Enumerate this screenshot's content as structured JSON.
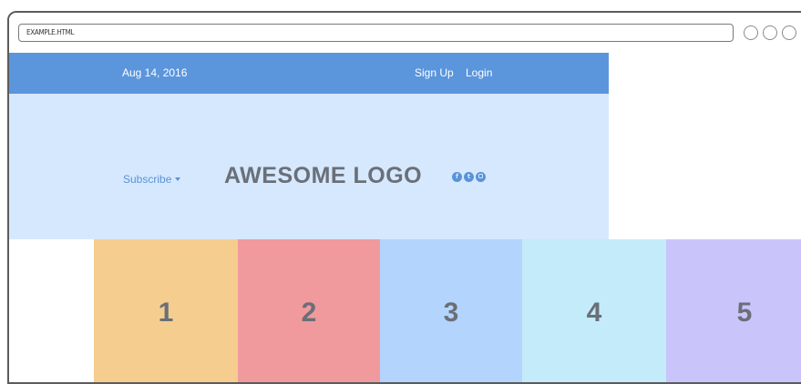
{
  "browser": {
    "address": "EXAMPLE.HTML"
  },
  "topbar": {
    "date": "Aug 14, 2016",
    "signup": "Sign Up",
    "login": "Login"
  },
  "header": {
    "subscribe": "Subscribe",
    "logo": "AWESOME LOGO",
    "social": [
      {
        "icon": "facebook-icon",
        "glyph": "f"
      },
      {
        "icon": "twitter-icon",
        "glyph": "t"
      },
      {
        "icon": "instagram-icon",
        "glyph": ""
      }
    ]
  },
  "tiles": [
    {
      "label": "1",
      "color": "#f5cd8f"
    },
    {
      "label": "2",
      "color": "#f09a9d"
    },
    {
      "label": "3",
      "color": "#b3d4fc"
    },
    {
      "label": "4",
      "color": "#c4ebf9"
    },
    {
      "label": "5",
      "color": "#c9c5fb"
    }
  ],
  "colors": {
    "topbar": "#5b95dc",
    "header": "#d6e8fd",
    "accent": "#5a93d8",
    "logo_text": "#6a6f78"
  }
}
